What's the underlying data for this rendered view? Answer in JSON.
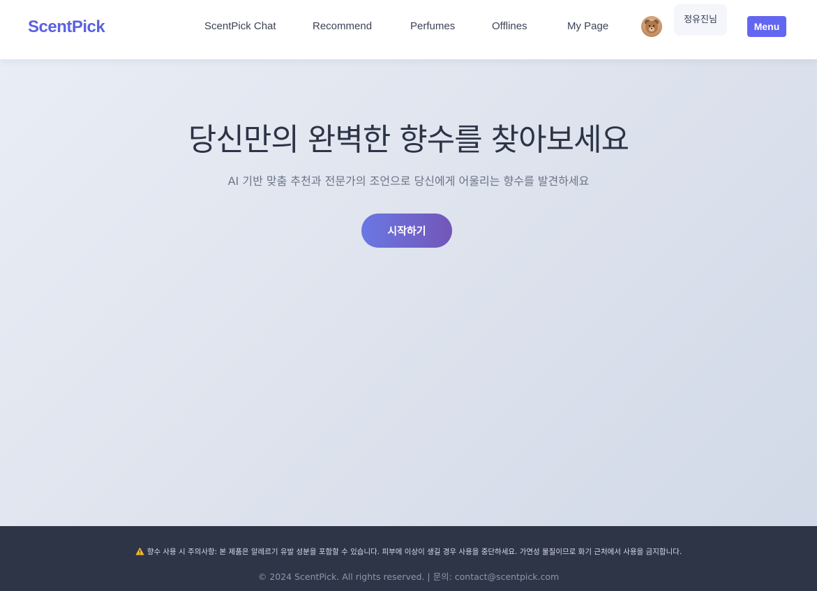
{
  "brand": {
    "name": "ScentPick",
    "color": "#5b61e0"
  },
  "nav": {
    "items": [
      {
        "label": "ScentPick Chat"
      },
      {
        "label": "Recommend"
      },
      {
        "label": "Perfumes"
      },
      {
        "label": "Offlines"
      },
      {
        "label": "My Page"
      }
    ],
    "avatar_icon": "teddy-bear-avatar",
    "user_name": "정유진님",
    "menu_label": "Menu",
    "menu_color": "#6366f1"
  },
  "hero": {
    "title": "당신만의 완벽한 향수를 찾아보세요",
    "subtitle": "AI 기반 맞춤 추천과 전문가의 조언으로 당신에게 어울리는 향수를 발견하세요",
    "cta_label": "시작하기"
  },
  "footer": {
    "warning_icon": "warning-triangle-icon",
    "notice": "향수 사용 시 주의사항: 본 제품은 알레르기 유발 성분을 포함할 수 있습니다. 피부에 이상이 생길 경우 사용을 중단하세요. 가연성 물질이므로 화기 근처에서 사용을 금지합니다.",
    "copyright": "© 2024 ScentPick. All rights reserved. | 문의: contact@scentpick.com"
  }
}
